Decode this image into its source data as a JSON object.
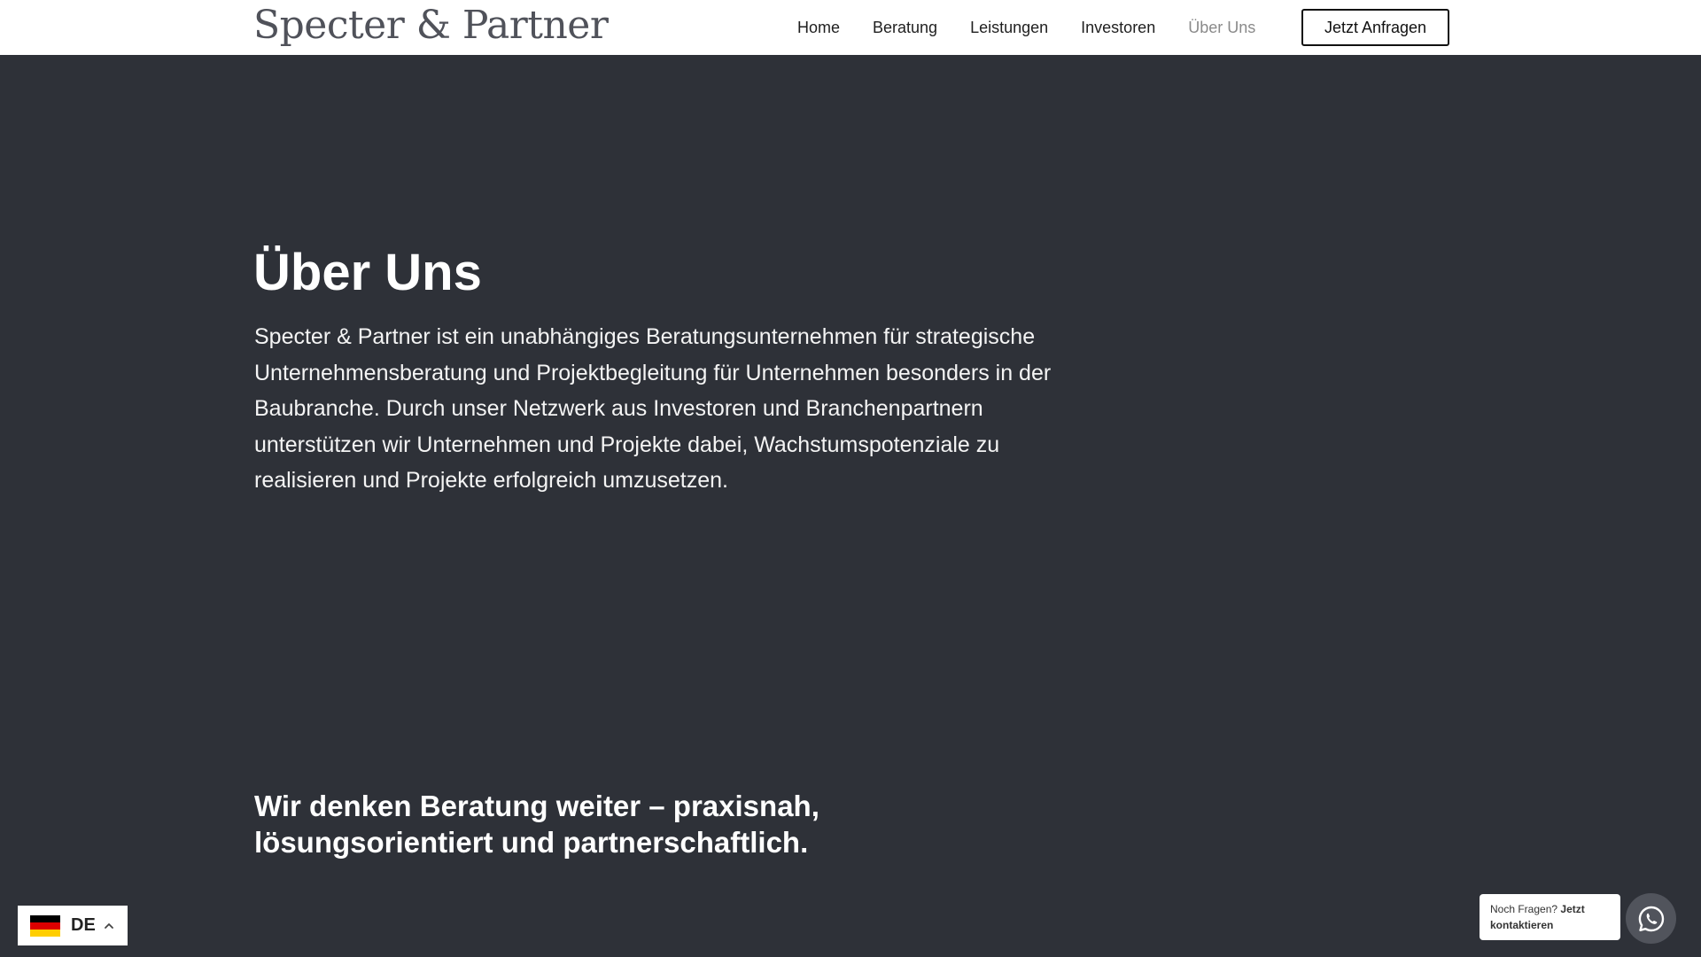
{
  "header": {
    "logo": "Specter & Partner",
    "nav": [
      "Home",
      "Beratung",
      "Leistungen",
      "Investoren",
      "Über Uns"
    ],
    "active_nav": "Über Uns",
    "cta": "Jetzt Anfragen"
  },
  "hero": {
    "title": "Über Uns",
    "text": "Specter & Partner ist ein unabhängiges Beratungsunternehmen für strategische Unternehmensberatung und Projektbegleitung für Unternehmen besonders in der Baubranche. Durch unser Netzwerk aus Investoren und Branchenpartnern unterstützen wir Unternehmen und Projekte dabei, Wachstumspotenziale zu realisieren und Projekte erfolgreich umzusetzen."
  },
  "section": {
    "heading": "Wir denken Beratung weiter – praxisnah, lösungsorientiert und partnerschaftlich."
  },
  "language": {
    "code": "DE",
    "flag_colors": [
      "#000000",
      "#dd0000",
      "#ffce00"
    ]
  },
  "chat": {
    "prompt": "Noch Fragen?",
    "link": "Jetzt kontaktieren",
    "icon": "whatsapp-icon"
  },
  "colors": {
    "background": "#2e3138",
    "header_bg": "#ffffff",
    "active_nav": "#8a8a8a"
  }
}
